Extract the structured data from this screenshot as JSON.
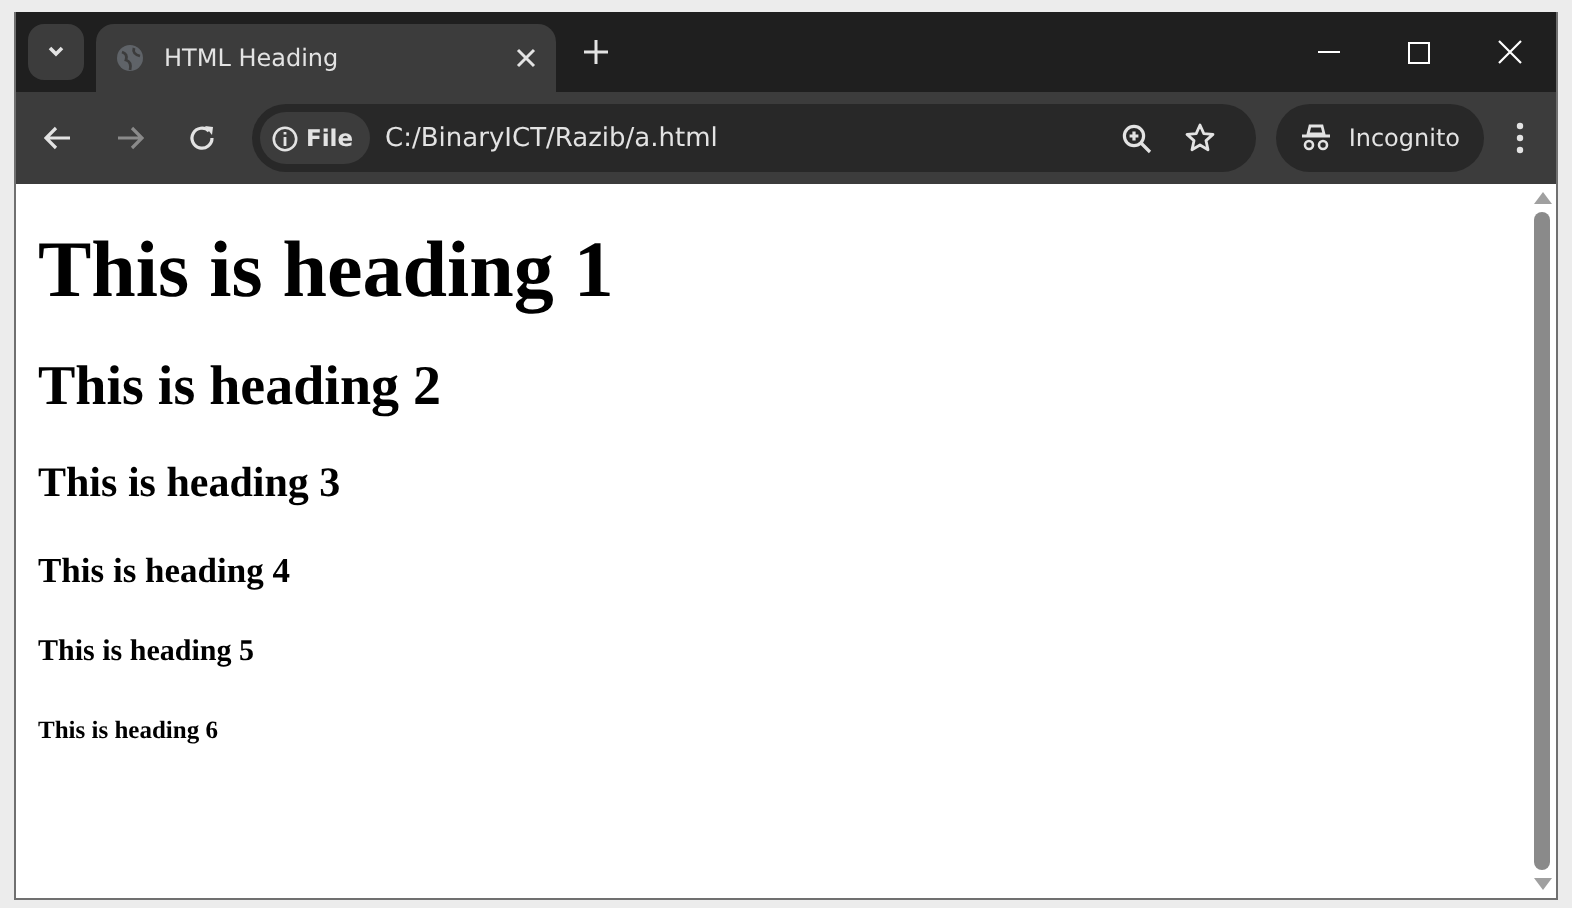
{
  "tabs": [
    {
      "title": "HTML Heading",
      "selected": true
    }
  ],
  "toolbar": {
    "back": {
      "disabled": false
    },
    "forward": {
      "disabled": true
    },
    "site_chip": "File",
    "url": "C:/BinaryICT/Razib/a.html",
    "profile": "Incognito"
  },
  "page": {
    "headings": [
      {
        "kind": "h1",
        "text": "This is heading 1"
      },
      {
        "kind": "h2",
        "text": "This is heading 2"
      },
      {
        "kind": "h3",
        "text": "This is heading 3"
      },
      {
        "kind": "h4",
        "text": "This is heading 4"
      },
      {
        "kind": "h5",
        "text": "This is heading 5"
      },
      {
        "kind": "h6",
        "text": "This is heading 6"
      }
    ]
  }
}
